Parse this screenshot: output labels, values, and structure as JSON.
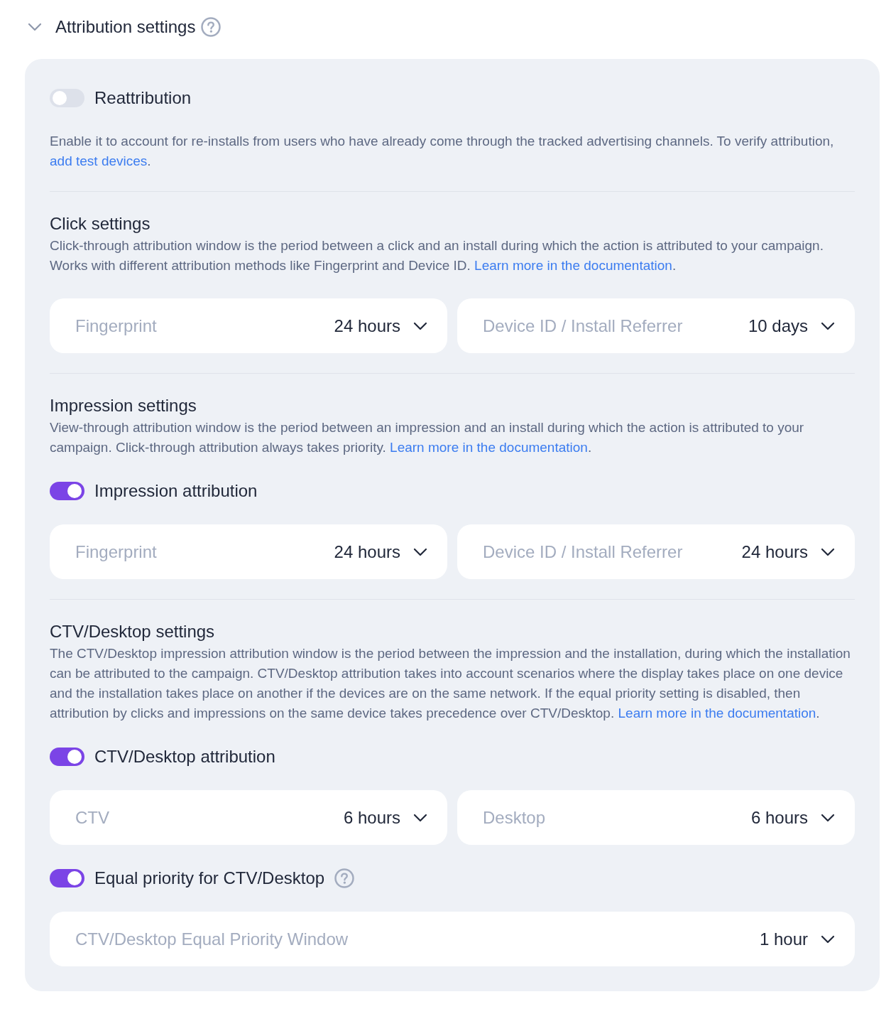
{
  "header": {
    "title": "Attribution settings",
    "expanded": true,
    "help": true
  },
  "sections": [
    {
      "items": [
        {
          "kind": "toggle",
          "label": "Reattribution",
          "on": false
        },
        {
          "kind": "paragraph",
          "text": "Enable it to account for re-installs from users who have already come through the tracked advertising channels. To verify attribution,",
          "link": "add test devices",
          "end": "."
        }
      ]
    },
    {
      "title": "Click settings",
      "items": [
        {
          "kind": "paragraph",
          "text": "Click-through attribution window is the period between a click and an install during which the action is attributed to your campaign. Works with different attribution methods like Fingerprint and Device ID.",
          "link": "Learn more in the documentation",
          "end": "."
        },
        {
          "kind": "selects",
          "fields": [
            {
              "label": "Fingerprint",
              "value": "24 hours"
            },
            {
              "label": "Device ID / Install Referrer",
              "value": "10 days"
            }
          ]
        }
      ]
    },
    {
      "title": "Impression settings",
      "items": [
        {
          "kind": "paragraph",
          "text": "View-through attribution window is the period between an impression and an install during which the action is attributed to your campaign. Click-through attribution always takes priority.",
          "link": "Learn more in the documentation",
          "end": "."
        },
        {
          "kind": "toggle",
          "label": "Impression attribution",
          "on": true
        },
        {
          "kind": "selects",
          "fields": [
            {
              "label": "Fingerprint",
              "value": "24 hours"
            },
            {
              "label": "Device ID / Install Referrer",
              "value": "24 hours"
            }
          ]
        }
      ]
    },
    {
      "title": "CTV/Desktop settings",
      "items": [
        {
          "kind": "paragraph",
          "text": "The CTV/Desktop impression attribution window is the period between the impression and the installation, during which the installation can be attributed to the campaign. CTV/Desktop attribution takes into account scenarios where the display takes place on one device and the installation takes place on another if the devices are on the same network. If the equal priority setting is disabled, then attribution by clicks and impressions on the same device takes precedence over CTV/Desktop.",
          "link": "Learn more in the documentation",
          "end": "."
        },
        {
          "kind": "toggle",
          "label": "CTV/Desktop attribution",
          "on": true
        },
        {
          "kind": "selects",
          "fields": [
            {
              "label": "CTV",
              "value": "6 hours"
            },
            {
              "label": "Desktop",
              "value": "6 hours"
            }
          ]
        },
        {
          "kind": "toggle",
          "label": "Equal priority for CTV/Desktop",
          "on": true,
          "help": true
        },
        {
          "kind": "selects",
          "fields": [
            {
              "label": "CTV/Desktop Equal Priority Window",
              "value": "1 hour"
            }
          ]
        }
      ]
    }
  ]
}
